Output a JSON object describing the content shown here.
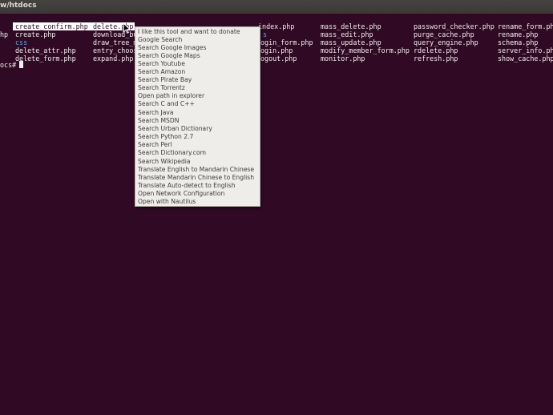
{
  "window": {
    "title": "w/htdocs"
  },
  "terminal": {
    "listing": [
      [
        "create_confirm.php",
        "delete.php",
        "",
        "",
        "index.php",
        "mass_delete.php",
        "password_checker.php",
        "rename_form.php"
      ],
      [
        "create.php",
        "download_bu",
        "",
        "s",
        "",
        "mass_edit.php",
        "purge_cache.php",
        "rename.php"
      ],
      [
        "css",
        "draw_tree_m",
        "",
        "ogin_form.php",
        "",
        "mass_update.php",
        "query_engine.php",
        "schema.php"
      ],
      [
        "delete_attr.php",
        "entry_choos",
        "",
        "ogin.php",
        "",
        "modify_member_form.php",
        "rdelete.php",
        "server_info.php"
      ],
      [
        "delete_form.php",
        "expand.php",
        "",
        "ogout.php",
        "",
        "monitor.php",
        "refresh.php",
        "show_cache.php"
      ]
    ],
    "left_fragment": "hp",
    "prompt": "ocs#"
  },
  "context_menu": {
    "items": [
      "I like this tool and want to donate",
      "Google Search",
      "Search Google Images",
      "Search Google Maps",
      "Search Youtube",
      "Search Amazon",
      "Search Pirate Bay",
      "Search Torrentz",
      "Open path in explorer",
      "Search C and C++",
      "Search Java",
      "Search MSDN",
      "Search Urban Dictionary",
      "Search Python 2.7",
      "Search Perl",
      "Search Dictionary.com",
      "Search Wikipedia",
      "Translate English to Mandarin Chinese",
      "Translate Mandarin Chinese to English",
      "Translate Auto-detect to English",
      "Open Network Configuration",
      "Open with Nautilus"
    ]
  },
  "colors": {
    "terminal_bg": "#300a24",
    "terminal_fg": "#eeeeec",
    "directory": "#5aa6e6",
    "menu_bg": "#efedea"
  },
  "icons": {
    "pointer": "arrow-cursor-icon"
  }
}
